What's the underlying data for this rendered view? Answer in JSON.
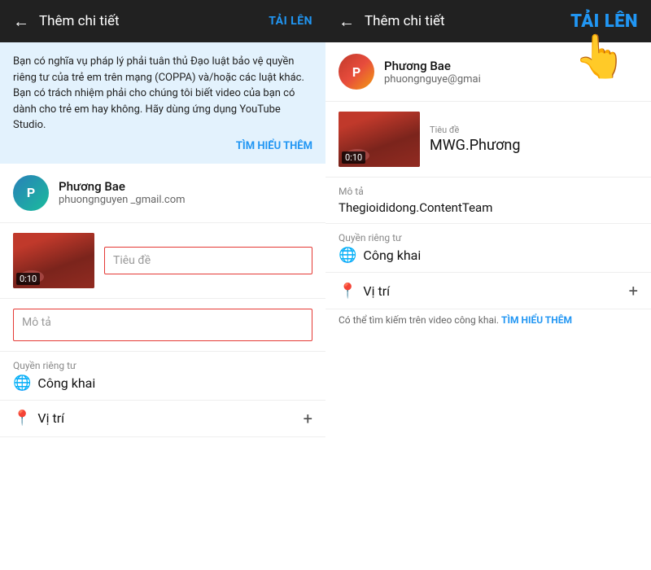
{
  "left_panel": {
    "header": {
      "back_label": "←",
      "title": "Thêm chi tiết",
      "upload_label": "TẢI LÊN"
    },
    "legal": {
      "text": "Bạn có nghĩa vụ pháp lý phải tuân thủ Đạo luật bảo vệ quyền riêng tư của trẻ em trên mạng (COPPA) và/hoặc các luật khác. Bạn có trách nhiệm phải cho chúng tôi biết video của bạn có dành cho trẻ em hay không. Hãy dùng ứng dụng YouTube Studio.",
      "learn_more": "TÌM HIỂU THÊM"
    },
    "user": {
      "name": "Phương Bae",
      "email": "phuongnguyen          _gmail.com",
      "avatar_initials": "P"
    },
    "video": {
      "duration": "0:10",
      "title_placeholder": "Tiêu đề"
    },
    "description_placeholder": "Mô tả",
    "privacy": {
      "label": "Quyền riêng tư",
      "value": "Công khai",
      "icon": "🌐"
    },
    "location": {
      "label": "Vị trí",
      "icon": "📍",
      "plus": "+"
    }
  },
  "right_panel": {
    "header": {
      "back_label": "←",
      "title": "Thêm chi tiết",
      "upload_label": "TẢI LÊN"
    },
    "user": {
      "name": "Phương Bae",
      "email_partial": "phuongnguye",
      "email_domain": "@gmai",
      "avatar_initials": "P"
    },
    "video": {
      "duration": "0:10",
      "title_label": "Tiêu đề",
      "title_value": "MWG.Phương"
    },
    "description": {
      "label": "Mô tả",
      "value": "Thegioididong.ContentTeam"
    },
    "privacy": {
      "label": "Quyền riêng tư",
      "value": "Công khai",
      "icon": "🌐"
    },
    "location": {
      "label": "Vị trí",
      "icon": "📍",
      "plus": "+",
      "note": "Có thể tìm kiếm trên video công khai.",
      "learn_more": "TÌM HIỂU THÊM"
    }
  }
}
